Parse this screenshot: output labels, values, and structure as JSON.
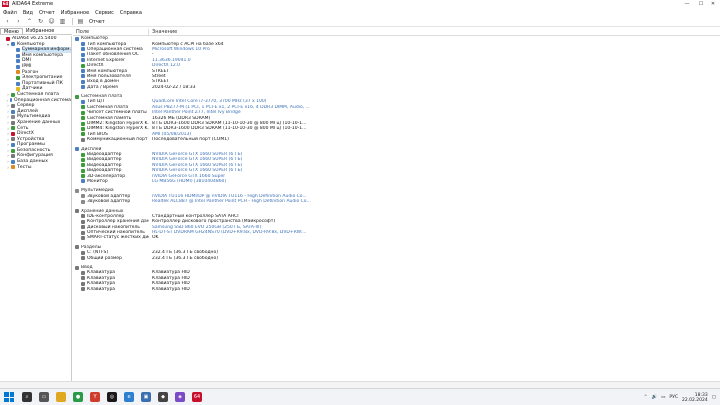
{
  "window": {
    "title": "AIDA64 Extreme",
    "app_icon": "64"
  },
  "menu": [
    "Файл",
    "Вид",
    "Отчет",
    "Избранное",
    "Сервис",
    "Справка"
  ],
  "toolbar": {
    "report_label": "Отчет"
  },
  "left_tabs": [
    "Меню",
    "Избранное"
  ],
  "tree": [
    {
      "label": "AIDA64 v6.25.5400",
      "level": 0,
      "exp": "",
      "color": "#c8102e"
    },
    {
      "label": "Компьютер",
      "level": 1,
      "exp": "▾",
      "color": "#4a7fc1"
    },
    {
      "label": "Суммарная информ.",
      "level": 2,
      "exp": "",
      "color": "#4a7fc1",
      "sel": true
    },
    {
      "label": "Имя компьютера",
      "level": 2,
      "exp": "",
      "color": "#4a7fc1"
    },
    {
      "label": "DMI",
      "level": 2,
      "exp": "",
      "color": "#4a7fc1"
    },
    {
      "label": "IPMI",
      "level": 2,
      "exp": "",
      "color": "#4a7fc1"
    },
    {
      "label": "Разгон",
      "level": 2,
      "exp": "",
      "color": "#e08a1e"
    },
    {
      "label": "Электропитание",
      "level": 2,
      "exp": "",
      "color": "#3a9d3a"
    },
    {
      "label": "Портативный ПК",
      "level": 2,
      "exp": "",
      "color": "#4a7fc1"
    },
    {
      "label": "Датчики",
      "level": 2,
      "exp": "",
      "color": "#e0b91e"
    },
    {
      "label": "Системная плата",
      "level": 1,
      "exp": "›",
      "color": "#3a9d3a"
    },
    {
      "label": "Операционная система",
      "level": 1,
      "exp": "›",
      "color": "#4a7fc1"
    },
    {
      "label": "Сервер",
      "level": 1,
      "exp": "›",
      "color": "#777"
    },
    {
      "label": "Дисплей",
      "level": 1,
      "exp": "›",
      "color": "#4a7fc1"
    },
    {
      "label": "Мультимедиа",
      "level": 1,
      "exp": "›",
      "color": "#888"
    },
    {
      "label": "Хранение данных",
      "level": 1,
      "exp": "›",
      "color": "#777"
    },
    {
      "label": "Сеть",
      "level": 1,
      "exp": "›",
      "color": "#3a9d3a"
    },
    {
      "label": "DirectX",
      "level": 1,
      "exp": "›",
      "color": "#c8102e"
    },
    {
      "label": "Устройства",
      "level": 1,
      "exp": "›",
      "color": "#777"
    },
    {
      "label": "Программы",
      "level": 1,
      "exp": "›",
      "color": "#4a7fc1"
    },
    {
      "label": "Безопасность",
      "level": 1,
      "exp": "›",
      "color": "#3a9d3a"
    },
    {
      "label": "Конфигурация",
      "level": 1,
      "exp": "›",
      "color": "#777"
    },
    {
      "label": "База данных",
      "level": 1,
      "exp": "›",
      "color": "#4a7fc1"
    },
    {
      "label": "Тесты",
      "level": 1,
      "exp": "›",
      "color": "#e08a1e"
    }
  ],
  "columns": {
    "field": "Поле",
    "value": "Значение"
  },
  "rows": [
    {
      "sec": true,
      "field": "Компьютер",
      "value": "",
      "color": "#4a7fc1"
    },
    {
      "field": "Тип компьютера",
      "value": "Компьютер с ACPI на базе x64",
      "color": "#4a7fc1"
    },
    {
      "field": "Операционная система",
      "value": "Microsoft Windows 10 Pro",
      "link": true,
      "color": "#4a7fc1"
    },
    {
      "field": "Пакет обновления ОС",
      "value": "-",
      "color": "#4a7fc1"
    },
    {
      "field": "Internet Explorer",
      "value": "11.3636.19041.0",
      "link": true,
      "color": "#4a7fc1"
    },
    {
      "field": "DirectX",
      "value": "DirectX 12.0",
      "link": true,
      "color": "#3a9d3a"
    },
    {
      "field": "Имя компьютера",
      "value": "STREET",
      "color": "#4a7fc1"
    },
    {
      "field": "Имя пользователя",
      "value": "Street",
      "color": "#4a7fc1"
    },
    {
      "field": "Вход в домен",
      "value": "STREET",
      "color": "#4a7fc1"
    },
    {
      "field": "Дата / Время",
      "value": "2024-02-22 / 18:33",
      "color": "#4a7fc1"
    },
    {
      "gap": true
    },
    {
      "sec": true,
      "field": "Системная плата",
      "value": "",
      "color": "#3a9d3a"
    },
    {
      "field": "Тип ЦП",
      "value": "QuadCore Intel Core i7-3770, 3700 MHz (37 x 100)",
      "link": true,
      "color": "#4a7fc1"
    },
    {
      "field": "Системная плата",
      "value": "Asus P8Z77-M (1 PCI, 1 PCI-E x1, 2 PCI-E x16, 4 DDR3 DIMM, Audio, ...",
      "link": true,
      "color": "#3a9d3a"
    },
    {
      "field": "Чипсет системной платы",
      "value": "Intel Panther Point Z77, Intel Ivy Bridge",
      "link": true,
      "color": "#3a9d3a"
    },
    {
      "field": "Системная память",
      "value": "16326 МБ (DDR3 SDRAM)",
      "color": "#3a9d3a"
    },
    {
      "field": "DIMM2: Kingston HyperX K...",
      "value": "8 ГБ DDR3-1600 DDR3 SDRAM (11-10-10-30 @ 800 МГц) (10-10-1...",
      "color": "#3a9d3a"
    },
    {
      "field": "DIMM4: Kingston HyperX K...",
      "value": "8 ГБ DDR3-1600 DDR3 SDRAM (11-10-10-30 @ 800 МГц) (10-10-1...",
      "color": "#3a9d3a"
    },
    {
      "field": "Тип BIOS",
      "value": "AMI (05/08/2013)",
      "link": true,
      "color": "#3a9d3a"
    },
    {
      "field": "Коммуникационный порт",
      "value": "Последовательный порт (COM1)",
      "color": "#777"
    },
    {
      "gap": true
    },
    {
      "sec": true,
      "field": "Дисплей",
      "value": "",
      "color": "#4a7fc1"
    },
    {
      "field": "Видеоадаптер",
      "value": "NVIDIA GeForce GTX 1660 SUPER (6 ГБ)",
      "link": true,
      "color": "#3a9d3a"
    },
    {
      "field": "Видеоадаптер",
      "value": "NVIDIA GeForce GTX 1660 SUPER (6 ГБ)",
      "link": true,
      "color": "#3a9d3a"
    },
    {
      "field": "Видеоадаптер",
      "value": "NVIDIA GeForce GTX 1660 SUPER (6 ГБ)",
      "link": true,
      "color": "#3a9d3a"
    },
    {
      "field": "Видеоадаптер",
      "value": "NVIDIA GeForce GTX 1660 SUPER (6 ГБ)",
      "link": true,
      "color": "#3a9d3a"
    },
    {
      "field": "3D-акселератор",
      "value": "nVIDIA GeForce GTX 1660 Super",
      "link": true,
      "color": "#3a9d3a"
    },
    {
      "field": "Монитор",
      "value": "LG MB56G (HDMI) [3810404860]",
      "link": true,
      "color": "#4a7fc1"
    },
    {
      "gap": true
    },
    {
      "sec": true,
      "field": "Мультимедиа",
      "value": "",
      "color": "#888"
    },
    {
      "field": "Звуковой адаптер",
      "value": "nVIDIA TU116 HDMI/DP @ nVIDIA TU116 - High Definition Audio Co...",
      "link": true,
      "color": "#888"
    },
    {
      "field": "Звуковой адаптер",
      "value": "Realtek ALC887 @ Intel Panther Point PCH - High Definition Audio Co...",
      "link": true,
      "color": "#888"
    },
    {
      "gap": true
    },
    {
      "sec": true,
      "field": "Хранение данных",
      "value": "",
      "color": "#777"
    },
    {
      "field": "IDE-контроллер",
      "value": "Стандартный контроллер SATA AHCI",
      "color": "#777"
    },
    {
      "field": "Контроллер хранения данных",
      "value": "Контроллер дискового пространства (Майкрософт)",
      "color": "#777"
    },
    {
      "field": "Дисковый накопитель",
      "value": "Samsung SSD 860 EVO 250GB (250 ГБ, SATA-III)",
      "link": true,
      "color": "#777"
    },
    {
      "field": "Оптический накопитель",
      "value": "HL-DT-ST DVDRAM GH24NS70 (DVD+R9:8x, DVD-R9:8x, DVD+RW:...",
      "link": true,
      "color": "#777"
    },
    {
      "field": "SMART-статус жёстких дисков",
      "value": "OK",
      "color": "#777"
    },
    {
      "gap": true
    },
    {
      "sec": true,
      "field": "Разделы",
      "value": "",
      "color": "#777"
    },
    {
      "field": "C: (NTFS)",
      "value": "232.4 ГБ (36.3 ГБ свободно)",
      "color": "#777"
    },
    {
      "field": "Общий размер",
      "value": "232.4 ГБ (36.3 ГБ свободно)",
      "color": "#777"
    },
    {
      "gap": true
    },
    {
      "sec": true,
      "field": "Ввод",
      "value": "",
      "color": "#777"
    },
    {
      "field": "Клавиатура",
      "value": "Клавиатура HID",
      "color": "#777"
    },
    {
      "field": "Клавиатура",
      "value": "Клавиатура HID",
      "color": "#777"
    },
    {
      "field": "Клавиатура",
      "value": "Клавиатура HID",
      "color": "#777"
    },
    {
      "field": "Клавиатура",
      "value": "Клавиатура HID",
      "color": "#777"
    }
  ],
  "taskbar": {
    "tray_lang": "РУС",
    "time": "18:33",
    "date": "22.02.2024",
    "aida_label": "64"
  }
}
